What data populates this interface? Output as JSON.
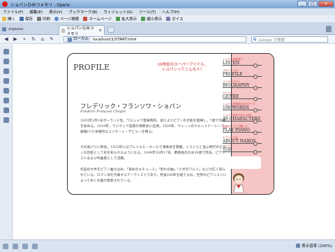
{
  "window": {
    "title": "ショパンひみつメモリ - Opera"
  },
  "menu": [
    "ファイル(F)",
    "編集(E)",
    "表示(V)",
    "ブックマーク(B)",
    "ウィジェット(G)",
    "ツール(T)",
    "ヘルプ(H)"
  ],
  "toolbar": [
    "開く",
    "保存",
    "印刷",
    "ページ検索",
    "ホームページ",
    "拡大表示",
    "縮小表示",
    "ボイス"
  ],
  "tabs": {
    "sidebar_label": "zrgazoo",
    "active": "ショパンひみつメモリ"
  },
  "address": {
    "chip": "ローカル",
    "url": "localhost/1/START.html"
  },
  "search": {
    "placeholder": "Google で検索"
  },
  "page": {
    "title": "PROFILE",
    "catch_line1": "19世紀のスーパーアイドル、",
    "catch_line2": "ショパンってこんな人！",
    "name_jp": "フレデリック・フランソワ・ショパン",
    "name_fr": "Frédéric François Chopin",
    "para1": "1810年3月1日ポーランド生。ワルシャワ音楽院卒。幼少よりピアノの才能を発揮し、7歳で作曲を始める。1818年、ラジヴィウ宮殿の演奏会に出演。1829年、ウィーンのケルントナートーア劇場(?)で本格的なコンサート・デビューを飾る。",
    "para2": "その後パリに移住。1832年にはプレイエル・ホールで演奏会を開催。リストらと並ぶ時代のピアノの巨匠として名を知られるようになる。1849年10月17日、肺結核のため39歳で死去。ピアニストおよび作曲家として活躍。",
    "para3": "作品の大半をピアノ曲が占め、「革命のエチュード」「別れの曲」「小犬のワルツ」などが広く知られている。ロマン派を代表するアーティストであり、死後200年を経てなお、世界のピアニストによって多くの曲が愛奏されている。"
  },
  "side_nav": [
    {
      "sub": "ショパンを学ぼう",
      "label": "LISTEN"
    },
    {
      "sub": "プロフィール",
      "label": "PROFILE"
    },
    {
      "sub": "バイオグラフィ",
      "label": "BIOGRAPHY"
    },
    {
      "sub": "ジャンル",
      "label": "GENRE"
    },
    {
      "sub": "ショパンを読める100ワード",
      "label": "100 WORDS"
    },
    {
      "sub": "ショパンをめぐる人々26",
      "label": "40 CHARACTERS"
    },
    {
      "sub": "名曲をピアノで弾こう",
      "label": "PLAY PIANO"
    },
    {
      "sub": "ナクソスとは",
      "label": "ABOUT NAXOS"
    },
    {
      "sub": "トップへ",
      "label": "TOP"
    }
  ],
  "status": {
    "zoom": "表示倍率 (100%)"
  }
}
